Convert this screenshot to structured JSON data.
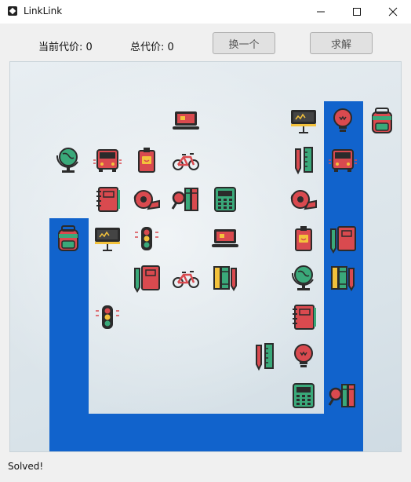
{
  "window": {
    "title": "LinkLink",
    "controls": [
      "minimize",
      "maximize",
      "close"
    ]
  },
  "toolbar": {
    "current_cost_label": "当前代价: 0",
    "total_cost_label": "总代价: 0",
    "shuffle_label": "换一个",
    "solve_label": "求解"
  },
  "board": {
    "cols": 10,
    "rows": 10,
    "tiles": [
      {
        "row": 1,
        "col": 3,
        "icon": "laptop-icon"
      },
      {
        "row": 1,
        "col": 6,
        "icon": "blackboard-icon"
      },
      {
        "row": 1,
        "col": 7,
        "icon": "lightbulb-icon"
      },
      {
        "row": 1,
        "col": 8,
        "icon": "backpack-icon",
        "highlight": true
      },
      {
        "row": 2,
        "col": 0,
        "icon": "globe-icon"
      },
      {
        "row": 2,
        "col": 1,
        "icon": "school-bus-icon"
      },
      {
        "row": 2,
        "col": 2,
        "icon": "id-badge-icon"
      },
      {
        "row": 2,
        "col": 3,
        "icon": "bicycle-icon"
      },
      {
        "row": 2,
        "col": 6,
        "icon": "ruler-pencil-icon"
      },
      {
        "row": 2,
        "col": 7,
        "icon": "school-bus-icon"
      },
      {
        "row": 3,
        "col": 1,
        "icon": "notebook-icon"
      },
      {
        "row": 3,
        "col": 2,
        "icon": "tape-icon"
      },
      {
        "row": 3,
        "col": 3,
        "icon": "magnifier-books-icon"
      },
      {
        "row": 3,
        "col": 4,
        "icon": "calculator-icon"
      },
      {
        "row": 3,
        "col": 6,
        "icon": "tape-icon"
      },
      {
        "row": 4,
        "col": 0,
        "icon": "backpack-icon",
        "highlight": true
      },
      {
        "row": 4,
        "col": 1,
        "icon": "blackboard-icon"
      },
      {
        "row": 4,
        "col": 2,
        "icon": "traffic-light-icon"
      },
      {
        "row": 4,
        "col": 4,
        "icon": "laptop-icon"
      },
      {
        "row": 4,
        "col": 6,
        "icon": "id-badge-icon"
      },
      {
        "row": 4,
        "col": 7,
        "icon": "notebook-pencil-icon"
      },
      {
        "row": 5,
        "col": 2,
        "icon": "notebook-pencil-icon"
      },
      {
        "row": 5,
        "col": 3,
        "icon": "bicycle-icon"
      },
      {
        "row": 5,
        "col": 4,
        "icon": "books-pencil-icon"
      },
      {
        "row": 5,
        "col": 6,
        "icon": "globe-icon"
      },
      {
        "row": 5,
        "col": 7,
        "icon": "books-pencil-icon"
      },
      {
        "row": 6,
        "col": 1,
        "icon": "traffic-light-icon"
      },
      {
        "row": 6,
        "col": 6,
        "icon": "notebook-icon"
      },
      {
        "row": 7,
        "col": 5,
        "icon": "ruler-pencil-icon"
      },
      {
        "row": 7,
        "col": 6,
        "icon": "lightbulb-icon"
      },
      {
        "row": 8,
        "col": 6,
        "icon": "calculator-icon"
      },
      {
        "row": 8,
        "col": 7,
        "icon": "magnifier-books-icon"
      }
    ],
    "path_color": "#1163cc"
  },
  "status": {
    "text": "Solved!"
  }
}
